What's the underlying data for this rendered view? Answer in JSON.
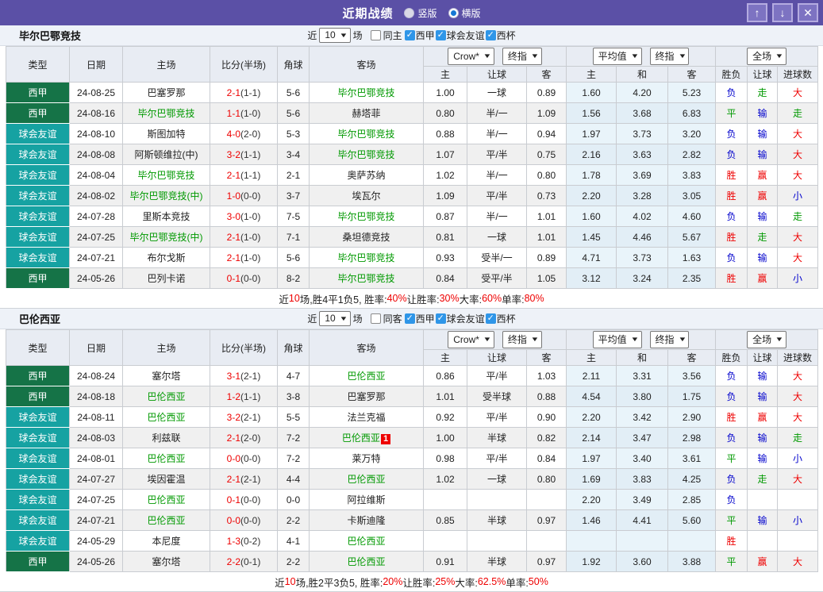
{
  "titlebar": {
    "title": "近期战绩",
    "radios": [
      {
        "label": "竖版",
        "selected": false
      },
      {
        "label": "横版",
        "selected": true
      }
    ],
    "buttons": {
      "up": "↑",
      "down": "↓",
      "close": "✕"
    }
  },
  "filters": {
    "prefix": "近",
    "count": "10",
    "suffix": "场",
    "leagues": [
      {
        "label": "西甲",
        "checked": true
      },
      {
        "label": "球会友谊",
        "checked": true
      },
      {
        "label": "西杯",
        "checked": true
      }
    ]
  },
  "header": {
    "type": "类型",
    "date": "日期",
    "home": "主场",
    "score": "比分(半场)",
    "corner": "角球",
    "away": "客场",
    "odds_select1": "Crow*",
    "odds_select2": "终指",
    "avg_select1": "平均值",
    "avg_select2": "终指",
    "scope_select": "全场",
    "sub": [
      "主",
      "让球",
      "客",
      "主",
      "和",
      "客",
      "胜负",
      "让球",
      "进球数"
    ]
  },
  "colors": {
    "liga": "#157347",
    "friendly": "#16a2a2",
    "accent": "#5b50a6",
    "win": "#e00",
    "draw": "#090",
    "lose": "#00c"
  },
  "sections": [
    {
      "team": "毕尔巴鄂竞技",
      "same_label": "同主",
      "same_checked": false,
      "rows": [
        {
          "type": "西甲",
          "k": "liga",
          "date": "24-08-25",
          "home": "巴塞罗那",
          "home_hl": false,
          "ft": "2-1",
          "ht": "(1-1)",
          "corner": "5-6",
          "away": "毕尔巴鄂竞技",
          "away_hl": true,
          "away_badge": "",
          "odds": [
            "1.00",
            "一球",
            "0.89"
          ],
          "avg": [
            "1.60",
            "4.20",
            "5.23"
          ],
          "res": [
            {
              "t": "负",
              "c": "b"
            },
            {
              "t": "走",
              "c": "g"
            },
            {
              "t": "大",
              "c": "r"
            }
          ]
        },
        {
          "type": "西甲",
          "k": "liga",
          "date": "24-08-16",
          "home": "毕尔巴鄂竞技",
          "home_hl": true,
          "ft": "1-1",
          "ht": "(1-0)",
          "corner": "5-6",
          "away": "赫塔菲",
          "away_hl": false,
          "away_badge": "",
          "odds": [
            "0.80",
            "半/一",
            "1.09"
          ],
          "avg": [
            "1.56",
            "3.68",
            "6.83"
          ],
          "res": [
            {
              "t": "平",
              "c": "g"
            },
            {
              "t": "输",
              "c": "b"
            },
            {
              "t": "走",
              "c": "g"
            }
          ]
        },
        {
          "type": "球会友谊",
          "k": "friendly",
          "date": "24-08-10",
          "home": "斯图加特",
          "home_hl": false,
          "ft": "4-0",
          "ht": "(2-0)",
          "corner": "5-3",
          "away": "毕尔巴鄂竞技",
          "away_hl": true,
          "away_badge": "",
          "odds": [
            "0.88",
            "半/一",
            "0.94"
          ],
          "avg": [
            "1.97",
            "3.73",
            "3.20"
          ],
          "res": [
            {
              "t": "负",
              "c": "b"
            },
            {
              "t": "输",
              "c": "b"
            },
            {
              "t": "大",
              "c": "r"
            }
          ]
        },
        {
          "type": "球会友谊",
          "k": "friendly",
          "date": "24-08-08",
          "home": "阿斯顿维拉(中)",
          "home_hl": false,
          "ft": "3-2",
          "ht": "(1-1)",
          "corner": "3-4",
          "away": "毕尔巴鄂竞技",
          "away_hl": true,
          "away_badge": "",
          "odds": [
            "1.07",
            "平/半",
            "0.75"
          ],
          "avg": [
            "2.16",
            "3.63",
            "2.82"
          ],
          "res": [
            {
              "t": "负",
              "c": "b"
            },
            {
              "t": "输",
              "c": "b"
            },
            {
              "t": "大",
              "c": "r"
            }
          ]
        },
        {
          "type": "球会友谊",
          "k": "friendly",
          "date": "24-08-04",
          "home": "毕尔巴鄂竞技",
          "home_hl": true,
          "ft": "2-1",
          "ht": "(1-1)",
          "corner": "2-1",
          "away": "奥萨苏纳",
          "away_hl": false,
          "away_badge": "",
          "odds": [
            "1.02",
            "半/一",
            "0.80"
          ],
          "avg": [
            "1.78",
            "3.69",
            "3.83"
          ],
          "res": [
            {
              "t": "胜",
              "c": "r"
            },
            {
              "t": "赢",
              "c": "r"
            },
            {
              "t": "大",
              "c": "r"
            }
          ]
        },
        {
          "type": "球会友谊",
          "k": "friendly",
          "date": "24-08-02",
          "home": "毕尔巴鄂竞技(中)",
          "home_hl": true,
          "ft": "1-0",
          "ht": "(0-0)",
          "corner": "3-7",
          "away": "埃瓦尔",
          "away_hl": false,
          "away_badge": "",
          "odds": [
            "1.09",
            "平/半",
            "0.73"
          ],
          "avg": [
            "2.20",
            "3.28",
            "3.05"
          ],
          "res": [
            {
              "t": "胜",
              "c": "r"
            },
            {
              "t": "赢",
              "c": "r"
            },
            {
              "t": "小",
              "c": "b"
            }
          ]
        },
        {
          "type": "球会友谊",
          "k": "friendly",
          "date": "24-07-28",
          "home": "里斯本竞技",
          "home_hl": false,
          "ft": "3-0",
          "ht": "(1-0)",
          "corner": "7-5",
          "away": "毕尔巴鄂竞技",
          "away_hl": true,
          "away_badge": "",
          "odds": [
            "0.87",
            "半/一",
            "1.01"
          ],
          "avg": [
            "1.60",
            "4.02",
            "4.60"
          ],
          "res": [
            {
              "t": "负",
              "c": "b"
            },
            {
              "t": "输",
              "c": "b"
            },
            {
              "t": "走",
              "c": "g"
            }
          ]
        },
        {
          "type": "球会友谊",
          "k": "friendly",
          "date": "24-07-25",
          "home": "毕尔巴鄂竞技(中)",
          "home_hl": true,
          "ft": "2-1",
          "ht": "(1-0)",
          "corner": "7-1",
          "away": "桑坦德竞技",
          "away_hl": false,
          "away_badge": "",
          "odds": [
            "0.81",
            "一球",
            "1.01"
          ],
          "avg": [
            "1.45",
            "4.46",
            "5.67"
          ],
          "res": [
            {
              "t": "胜",
              "c": "r"
            },
            {
              "t": "走",
              "c": "g"
            },
            {
              "t": "大",
              "c": "r"
            }
          ]
        },
        {
          "type": "球会友谊",
          "k": "friendly",
          "date": "24-07-21",
          "home": "布尔戈斯",
          "home_hl": false,
          "ft": "2-1",
          "ht": "(1-0)",
          "corner": "5-6",
          "away": "毕尔巴鄂竞技",
          "away_hl": true,
          "away_badge": "",
          "odds": [
            "0.93",
            "受半/一",
            "0.89"
          ],
          "avg": [
            "4.71",
            "3.73",
            "1.63"
          ],
          "res": [
            {
              "t": "负",
              "c": "b"
            },
            {
              "t": "输",
              "c": "b"
            },
            {
              "t": "大",
              "c": "r"
            }
          ]
        },
        {
          "type": "西甲",
          "k": "liga",
          "date": "24-05-26",
          "home": "巴列卡诺",
          "home_hl": false,
          "ft": "0-1",
          "ht": "(0-0)",
          "corner": "8-2",
          "away": "毕尔巴鄂竞技",
          "away_hl": true,
          "away_badge": "",
          "odds": [
            "0.84",
            "受平/半",
            "1.05"
          ],
          "avg": [
            "3.12",
            "3.24",
            "2.35"
          ],
          "res": [
            {
              "t": "胜",
              "c": "r"
            },
            {
              "t": "赢",
              "c": "r"
            },
            {
              "t": "小",
              "c": "b"
            }
          ]
        }
      ],
      "summary": [
        {
          "t": "近",
          "red": false
        },
        {
          "t": "10",
          "red": true
        },
        {
          "t": "场,胜4平1负5, 胜率:",
          "red": false
        },
        {
          "t": "40%",
          "red": true
        },
        {
          "t": " 让胜率:",
          "red": false
        },
        {
          "t": "30%",
          "red": true
        },
        {
          "t": " 大率:",
          "red": false
        },
        {
          "t": "60%",
          "red": true
        },
        {
          "t": " 单率:",
          "red": false
        },
        {
          "t": "80%",
          "red": true
        }
      ]
    },
    {
      "team": "巴伦西亚",
      "same_label": "同客",
      "same_checked": false,
      "rows": [
        {
          "type": "西甲",
          "k": "liga",
          "date": "24-08-24",
          "home": "塞尔塔",
          "home_hl": false,
          "ft": "3-1",
          "ht": "(2-1)",
          "corner": "4-7",
          "away": "巴伦西亚",
          "away_hl": true,
          "away_badge": "",
          "odds": [
            "0.86",
            "平/半",
            "1.03"
          ],
          "avg": [
            "2.11",
            "3.31",
            "3.56"
          ],
          "res": [
            {
              "t": "负",
              "c": "b"
            },
            {
              "t": "输",
              "c": "b"
            },
            {
              "t": "大",
              "c": "r"
            }
          ]
        },
        {
          "type": "西甲",
          "k": "liga",
          "date": "24-08-18",
          "home": "巴伦西亚",
          "home_hl": true,
          "ft": "1-2",
          "ht": "(1-1)",
          "corner": "3-8",
          "away": "巴塞罗那",
          "away_hl": false,
          "away_badge": "",
          "odds": [
            "1.01",
            "受半球",
            "0.88"
          ],
          "avg": [
            "4.54",
            "3.80",
            "1.75"
          ],
          "res": [
            {
              "t": "负",
              "c": "b"
            },
            {
              "t": "输",
              "c": "b"
            },
            {
              "t": "大",
              "c": "r"
            }
          ]
        },
        {
          "type": "球会友谊",
          "k": "friendly",
          "date": "24-08-11",
          "home": "巴伦西亚",
          "home_hl": true,
          "ft": "3-2",
          "ht": "(2-1)",
          "corner": "5-5",
          "away": "法兰克福",
          "away_hl": false,
          "away_badge": "",
          "odds": [
            "0.92",
            "平/半",
            "0.90"
          ],
          "avg": [
            "2.20",
            "3.42",
            "2.90"
          ],
          "res": [
            {
              "t": "胜",
              "c": "r"
            },
            {
              "t": "赢",
              "c": "r"
            },
            {
              "t": "大",
              "c": "r"
            }
          ]
        },
        {
          "type": "球会友谊",
          "k": "friendly",
          "date": "24-08-03",
          "home": "利兹联",
          "home_hl": false,
          "ft": "2-1",
          "ht": "(2-0)",
          "corner": "7-2",
          "away": "巴伦西亚",
          "away_hl": true,
          "away_badge": "1",
          "odds": [
            "1.00",
            "半球",
            "0.82"
          ],
          "avg": [
            "2.14",
            "3.47",
            "2.98"
          ],
          "res": [
            {
              "t": "负",
              "c": "b"
            },
            {
              "t": "输",
              "c": "b"
            },
            {
              "t": "走",
              "c": "g"
            }
          ]
        },
        {
          "type": "球会友谊",
          "k": "friendly",
          "date": "24-08-01",
          "home": "巴伦西亚",
          "home_hl": true,
          "ft": "0-0",
          "ht": "(0-0)",
          "corner": "7-2",
          "away": "莱万特",
          "away_hl": false,
          "away_badge": "",
          "odds": [
            "0.98",
            "平/半",
            "0.84"
          ],
          "avg": [
            "1.97",
            "3.40",
            "3.61"
          ],
          "res": [
            {
              "t": "平",
              "c": "g"
            },
            {
              "t": "输",
              "c": "b"
            },
            {
              "t": "小",
              "c": "b"
            }
          ]
        },
        {
          "type": "球会友谊",
          "k": "friendly",
          "date": "24-07-27",
          "home": "埃因霍温",
          "home_hl": false,
          "ft": "2-1",
          "ht": "(2-1)",
          "corner": "4-4",
          "away": "巴伦西亚",
          "away_hl": true,
          "away_badge": "",
          "odds": [
            "1.02",
            "一球",
            "0.80"
          ],
          "avg": [
            "1.69",
            "3.83",
            "4.25"
          ],
          "res": [
            {
              "t": "负",
              "c": "b"
            },
            {
              "t": "走",
              "c": "g"
            },
            {
              "t": "大",
              "c": "r"
            }
          ]
        },
        {
          "type": "球会友谊",
          "k": "friendly",
          "date": "24-07-25",
          "home": "巴伦西亚",
          "home_hl": true,
          "ft": "0-1",
          "ht": "(0-0)",
          "corner": "0-0",
          "away": "阿拉维斯",
          "away_hl": false,
          "away_badge": "",
          "odds": [
            "",
            "",
            ""
          ],
          "avg": [
            "2.20",
            "3.49",
            "2.85"
          ],
          "res": [
            {
              "t": "负",
              "c": "b"
            },
            {
              "t": "",
              "c": "b"
            },
            {
              "t": "",
              "c": "b"
            }
          ]
        },
        {
          "type": "球会友谊",
          "k": "friendly",
          "date": "24-07-21",
          "home": "巴伦西亚",
          "home_hl": true,
          "ft": "0-0",
          "ht": "(0-0)",
          "corner": "2-2",
          "away": "卡斯迪隆",
          "away_hl": false,
          "away_badge": "",
          "odds": [
            "0.85",
            "半球",
            "0.97"
          ],
          "avg": [
            "1.46",
            "4.41",
            "5.60"
          ],
          "res": [
            {
              "t": "平",
              "c": "g"
            },
            {
              "t": "输",
              "c": "b"
            },
            {
              "t": "小",
              "c": "b"
            }
          ]
        },
        {
          "type": "球会友谊",
          "k": "friendly",
          "date": "24-05-29",
          "home": "本尼度",
          "home_hl": false,
          "ft": "1-3",
          "ht": "(0-2)",
          "corner": "4-1",
          "away": "巴伦西亚",
          "away_hl": true,
          "away_badge": "",
          "odds": [
            "",
            "",
            ""
          ],
          "avg": [
            "",
            "",
            ""
          ],
          "res": [
            {
              "t": "胜",
              "c": "r"
            },
            {
              "t": "",
              "c": "b"
            },
            {
              "t": "",
              "c": "b"
            }
          ]
        },
        {
          "type": "西甲",
          "k": "liga",
          "date": "24-05-26",
          "home": "塞尔塔",
          "home_hl": false,
          "ft": "2-2",
          "ht": "(0-1)",
          "corner": "2-2",
          "away": "巴伦西亚",
          "away_hl": true,
          "away_badge": "",
          "odds": [
            "0.91",
            "半球",
            "0.97"
          ],
          "avg": [
            "1.92",
            "3.60",
            "3.88"
          ],
          "res": [
            {
              "t": "平",
              "c": "g"
            },
            {
              "t": "赢",
              "c": "r"
            },
            {
              "t": "大",
              "c": "r"
            }
          ]
        }
      ],
      "summary": [
        {
          "t": "近",
          "red": false
        },
        {
          "t": "10",
          "red": true
        },
        {
          "t": "场,胜2平3负5, 胜率:",
          "red": false
        },
        {
          "t": "20%",
          "red": true
        },
        {
          "t": " 让胜率:",
          "red": false
        },
        {
          "t": "25%",
          "red": true
        },
        {
          "t": " 大率:",
          "red": false
        },
        {
          "t": "62.5%",
          "red": true
        },
        {
          "t": " 单率:",
          "red": false
        },
        {
          "t": "50%",
          "red": true
        }
      ]
    }
  ]
}
